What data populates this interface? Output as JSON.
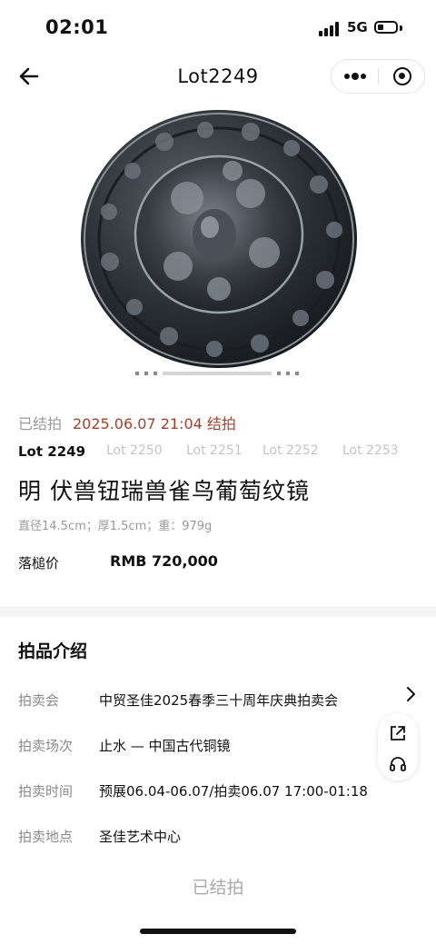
{
  "status_bar": {
    "time": "02:01",
    "network": "5G"
  },
  "nav": {
    "title": "Lot2249"
  },
  "lot_status": {
    "ended_label": "已结拍",
    "ended_datetime": "2025.06.07 21:04 结拍"
  },
  "lot_tabs": [
    {
      "label": "Lot 2249",
      "active": true
    },
    {
      "label": "Lot 2250",
      "active": false
    },
    {
      "label": "Lot 2251",
      "active": false
    },
    {
      "label": "Lot 2252",
      "active": false
    },
    {
      "label": "Lot 2253",
      "active": false
    }
  ],
  "lot": {
    "title": "明 伏兽钮瑞兽雀鸟葡萄纹镜",
    "specs": "直径14.5cm；厚1.5cm；重：979g",
    "price_label": "落槌价",
    "price_value": "RMB 720,000"
  },
  "intro": {
    "title": "拍品介绍",
    "rows": [
      {
        "label": "拍卖会",
        "value": "中贸圣佳2025春季三十周年庆典拍卖会"
      },
      {
        "label": "拍卖场次",
        "value": "止水 — 中国古代铜镜"
      },
      {
        "label": "拍卖时间",
        "value": "预展06.04-06.07/拍卖06.07 17:00-01:18"
      },
      {
        "label": "拍卖地点",
        "value": "圣佳艺术中心"
      }
    ]
  },
  "footer": {
    "ended_button": "已结拍"
  },
  "colors": {
    "accent_red": "#a5412a",
    "muted": "#9a9a9a"
  }
}
